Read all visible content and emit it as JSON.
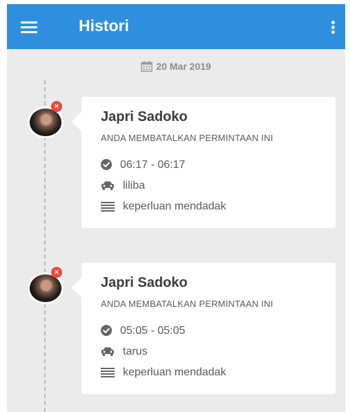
{
  "appbar": {
    "title": "Histori",
    "menu_icon": "hamburger-menu-icon",
    "more_icon": "more-vert-icon",
    "color": "#2f8fde"
  },
  "date": "20 Mar 2019",
  "history": [
    {
      "name": "Japri Sadoko",
      "status": "ANDA MEMBATALKAN PERMINTAAN INI",
      "time": "06:17 - 06:17",
      "vehicle": "liliba",
      "purpose": "keperluan mendadak"
    },
    {
      "name": "Japri Sadoko",
      "status": "ANDA MEMBATALKAN PERMINTAAN INI",
      "time": "05:05 - 05:05",
      "vehicle": "tarus",
      "purpose": "keperluan mendadak"
    }
  ],
  "colors": {
    "badge": "#e74c3c",
    "background": "#ebebeb"
  }
}
